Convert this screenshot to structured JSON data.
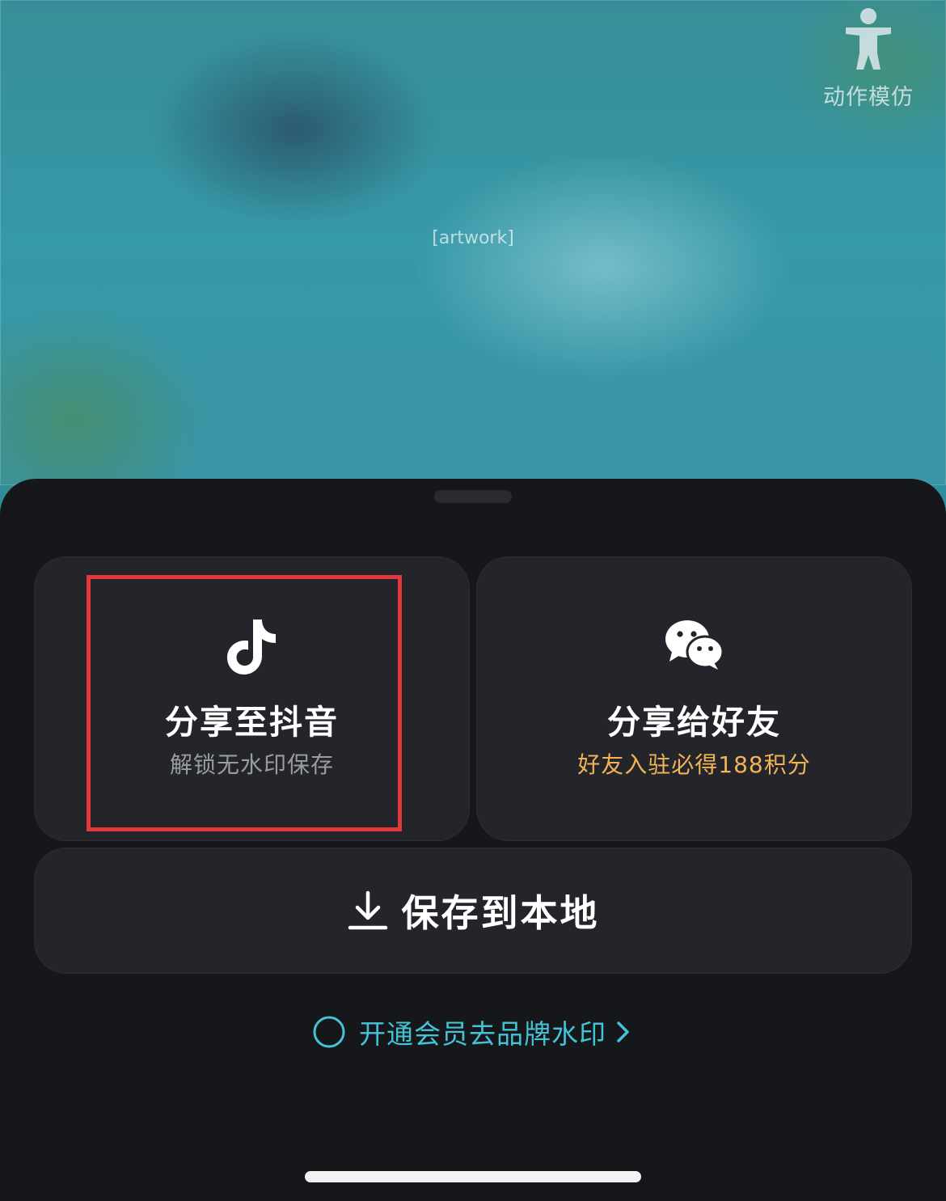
{
  "artwork": {
    "placeholder_label": "[artwork]",
    "motion_button": {
      "label": "动作模仿",
      "icon": "person-icon"
    }
  },
  "share_sheet": {
    "douyin": {
      "title": "分享至抖音",
      "subtitle": "解锁无水印保存",
      "icon": "douyin-icon",
      "subtitle_color": "#9a9ca3"
    },
    "wechat": {
      "title": "分享给好友",
      "subtitle": "好友入驻必得188积分",
      "icon": "wechat-icon",
      "subtitle_color": "#f2b256"
    },
    "save": {
      "label": "保存到本地",
      "icon": "download-icon"
    },
    "vip": {
      "label": "开通会员去品牌水印",
      "icon": "radio-circle-icon",
      "arrow_icon": "chevron-right-icon",
      "color": "#45c3d6"
    },
    "highlight_color": "#e23a3c"
  }
}
